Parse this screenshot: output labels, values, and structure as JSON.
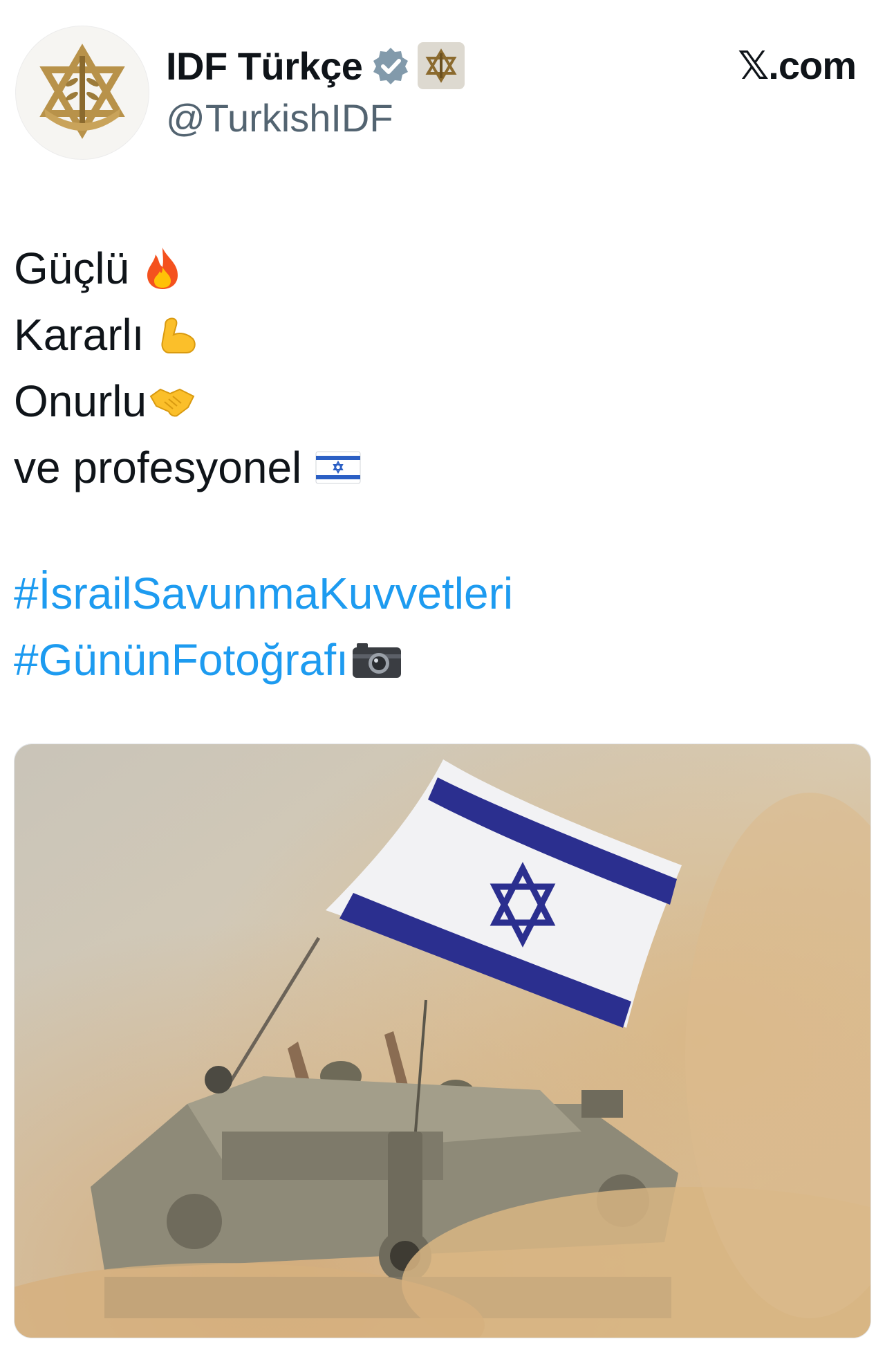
{
  "account": {
    "display_name": "IDF Türkçe",
    "handle": "@TurkishIDF",
    "verified_icon": "verified-badge-icon",
    "affiliation_icon": "idf-emblem-icon",
    "avatar_icon": "idf-emblem-icon"
  },
  "brand": {
    "label": "𝕏.com"
  },
  "post": {
    "lines": [
      {
        "text": "Güçlü",
        "emoji": "fire-icon"
      },
      {
        "text": "Kararlı",
        "emoji": "flexed-biceps-icon"
      },
      {
        "text": "Onurlu",
        "emoji": "handshake-icon"
      },
      {
        "text": "ve profesyonel",
        "emoji": "israel-flag-icon"
      }
    ],
    "hashtags": [
      {
        "text": "#İsrailSavunmaKuvvetleri"
      },
      {
        "text": "#GününFotoğrafı",
        "emoji": "camera-icon"
      }
    ]
  },
  "media": {
    "kind": "photo",
    "subject_icons": [
      "israel-flag-icon",
      "tank-icon",
      "soldier-icon"
    ]
  },
  "colors": {
    "text": "#0f1419",
    "secondary_text": "#536471",
    "hashtag": "#1d9bf0",
    "verified": "#829aab",
    "flag_blue": "#2b2f8f",
    "dust": "#d2b48c"
  }
}
